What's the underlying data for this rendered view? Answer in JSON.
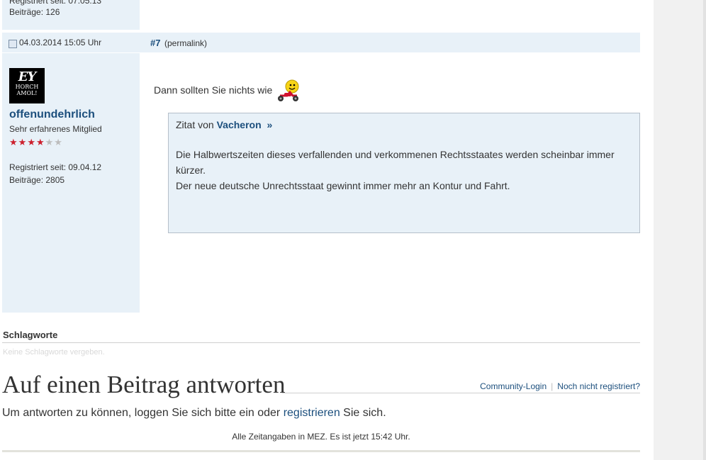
{
  "previous_post": {
    "registered": "Registriert seit: 07.05.13",
    "posts": "Beiträge: 126"
  },
  "post": {
    "date": "04.03.2014 15:05 Uhr",
    "number": "#7",
    "permalink": "(permalink)",
    "message": "Dann sollten Sie nichts wie",
    "smiley_icon": "scooter-smiley-icon"
  },
  "user": {
    "avatar_text_top": "EY",
    "avatar_text_bottom": [
      "HORCH",
      "AMOL!"
    ],
    "name": "offenundehrlich",
    "rank": "Sehr erfahrenes Mitglied",
    "stars_filled": 4,
    "stars_total": 6,
    "registered": "Registriert seit: 09.04.12",
    "posts": "Beiträge: 2805"
  },
  "quote": {
    "prefix": "Zitat von",
    "author": "Vacheron",
    "arrow": "»",
    "lines": [
      "Die Halbwertszeiten dieses verfallenden und verkommenen Rechtsstaates werden scheinbar immer kürzer.",
      "Der neue deutsche Unrechtsstaat gewinnt immer mehr an Kontur und Fahrt."
    ]
  },
  "tags": {
    "title": "Schlagworte",
    "none": "Keine Schlagworte vergeben."
  },
  "reply": {
    "title": "Auf einen Beitrag antworten",
    "login_link": "Community-Login",
    "separator": "|",
    "register_link": "Noch nicht registriert?",
    "text_before": "Um antworten zu können, loggen Sie sich bitte ein oder",
    "text_link": "registrieren",
    "text_after": "Sie sich."
  },
  "footer": {
    "time": "Alle Zeitangaben in MEZ. Es ist jetzt 15:42 Uhr."
  },
  "colors": {
    "accent": "#1c4f7d",
    "panel": "#e8f1f8",
    "star": "#cc1f2d"
  }
}
